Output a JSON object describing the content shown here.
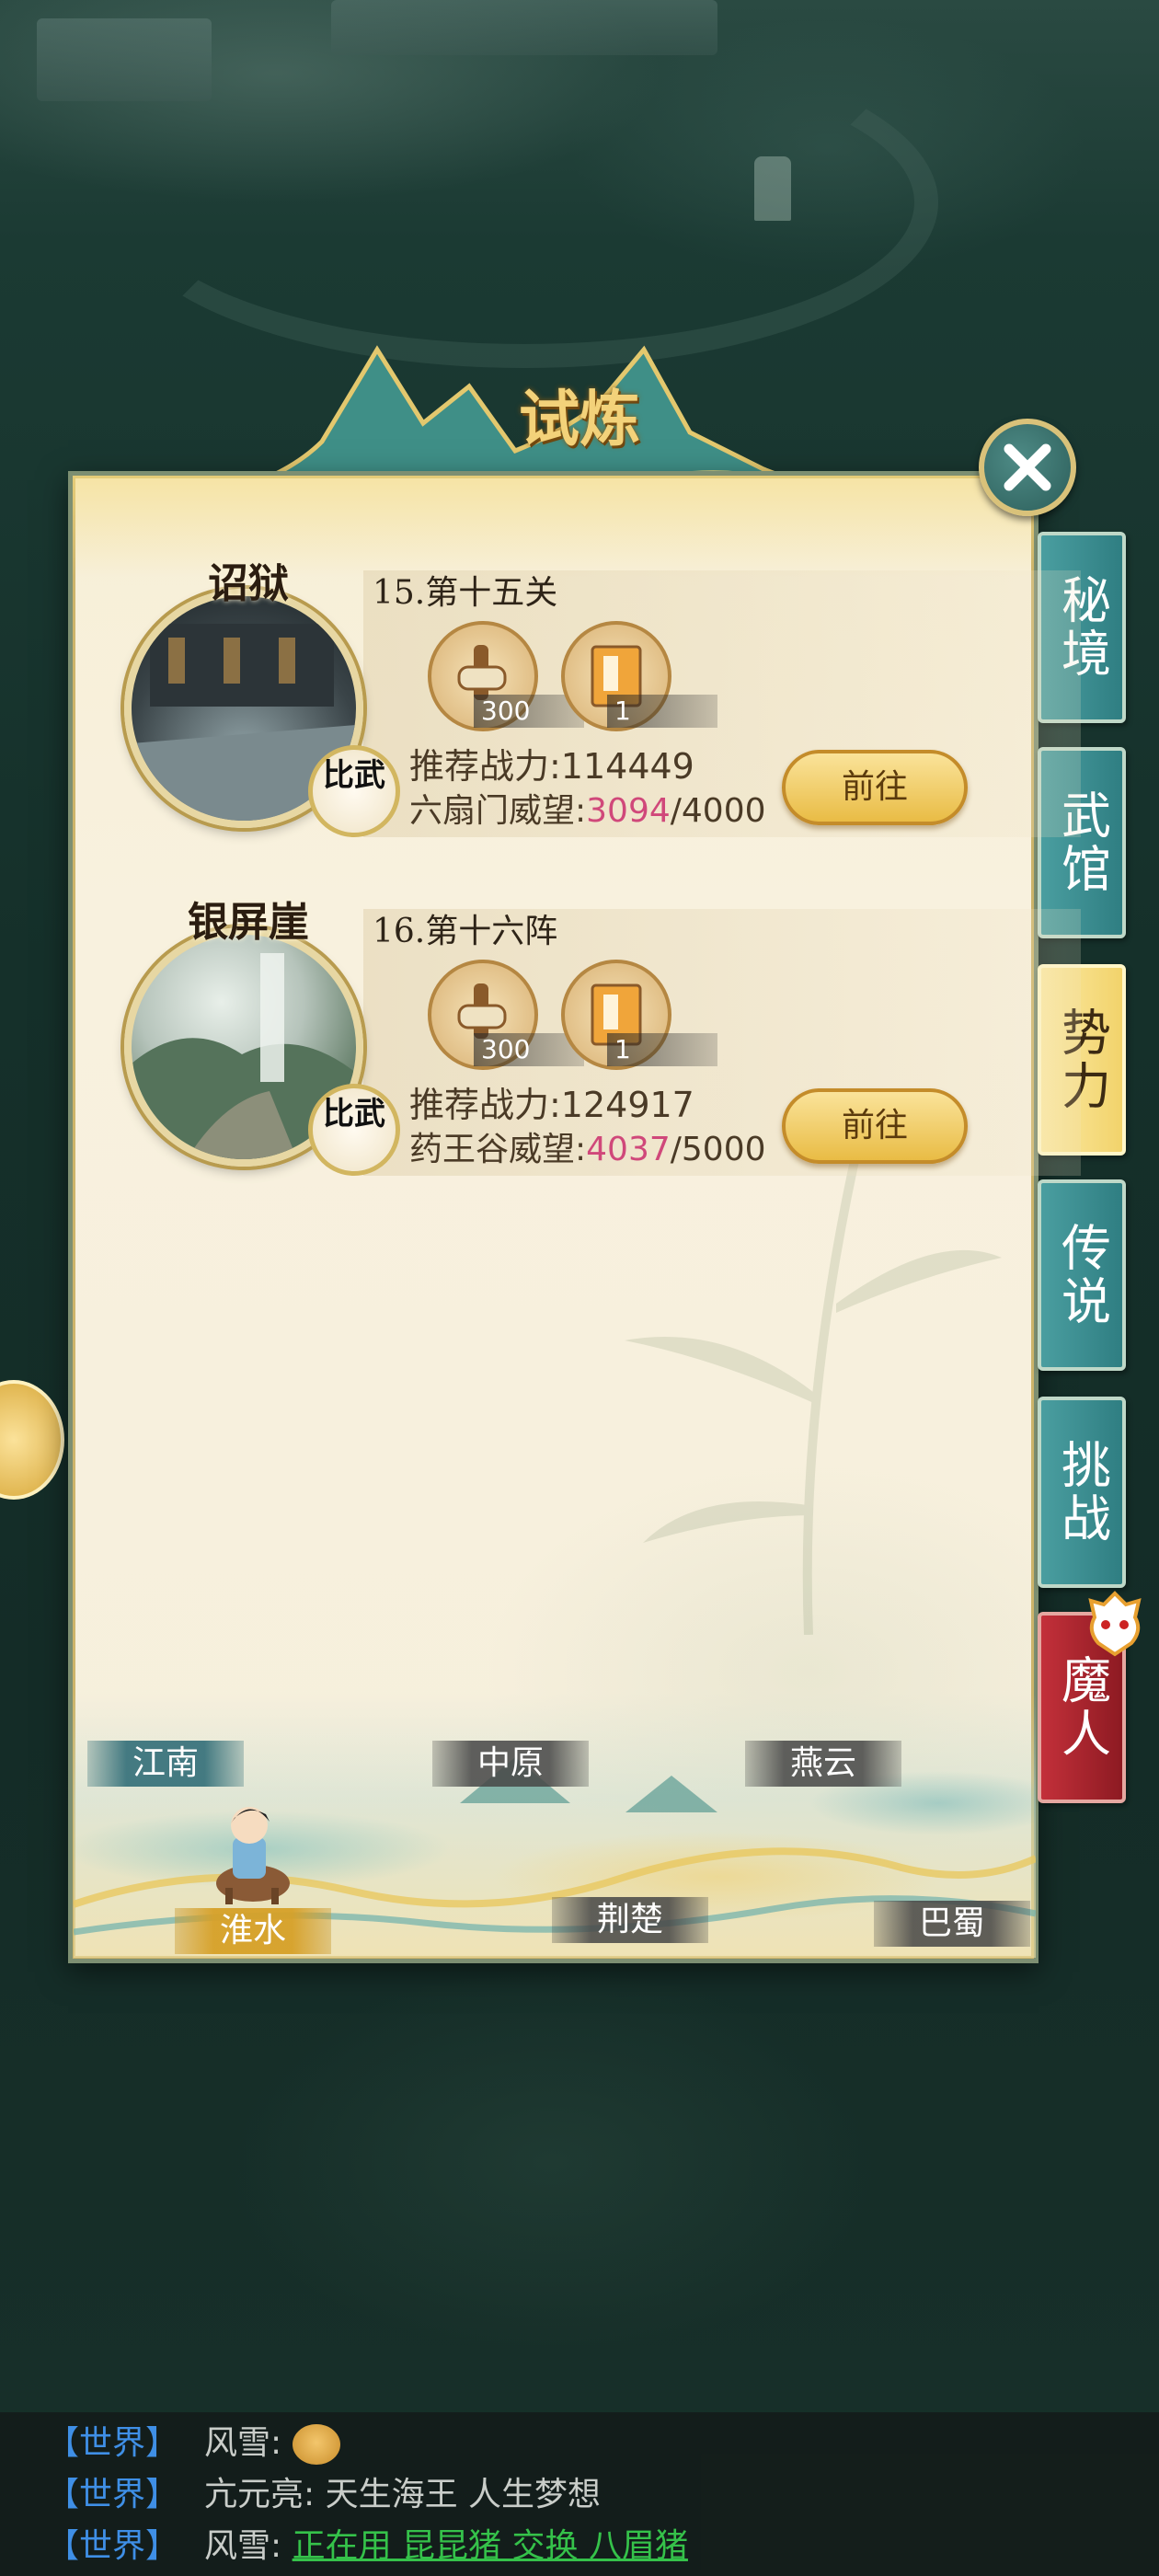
{
  "title": "试炼",
  "side_tabs": [
    {
      "label": "秘境",
      "active": false
    },
    {
      "label": "武馆",
      "active": false
    },
    {
      "label": "势力",
      "active": true
    },
    {
      "label": "传说",
      "active": false
    },
    {
      "label": "挑战",
      "active": false
    },
    {
      "label": "魔人",
      "active": false
    }
  ],
  "entries": [
    {
      "location": "诏狱",
      "stage": "15.第十五关",
      "rewards": [
        {
          "icon": "scroll-icon",
          "count": "300"
        },
        {
          "icon": "book-icon",
          "count": "1"
        }
      ],
      "badge": "比武",
      "power_label": "推荐战力:114449",
      "rep_label": "六扇门威望:",
      "rep_current": "3094",
      "rep_max": "/4000",
      "button": "前往"
    },
    {
      "location": "银屏崖",
      "stage": "16.第十六阵",
      "rewards": [
        {
          "icon": "scroll-icon",
          "count": "300"
        },
        {
          "icon": "book-icon",
          "count": "1"
        }
      ],
      "badge": "比武",
      "power_label": "推荐战力:124917",
      "rep_label": "药王谷威望:",
      "rep_current": "4037",
      "rep_max": "/5000",
      "button": "前往"
    }
  ],
  "regions": [
    {
      "name": "江南"
    },
    {
      "name": "中原"
    },
    {
      "name": "燕云"
    },
    {
      "name": "淮水"
    },
    {
      "name": "荆楚"
    },
    {
      "name": "巴蜀"
    }
  ],
  "current_region": "淮水",
  "chat": [
    {
      "channel": "【世界】",
      "user": "风雪:",
      "message": ""
    },
    {
      "channel": "【世界】",
      "user": "亢元亮:",
      "message": "天生海王 人生梦想"
    },
    {
      "channel": "【世界】",
      "user": "风雪:",
      "message": "正在用 昆昆猪 交换 八眉猪"
    }
  ],
  "colors": {
    "accent_gold": "#e9bc45",
    "tab_teal": "#2f7e82",
    "tab_active": "#f2d36b",
    "tab_demon": "#8d1a22",
    "rep_current": "#d0487a",
    "chat_channel": "#3f8fe6",
    "chat_link": "#35c24a"
  }
}
